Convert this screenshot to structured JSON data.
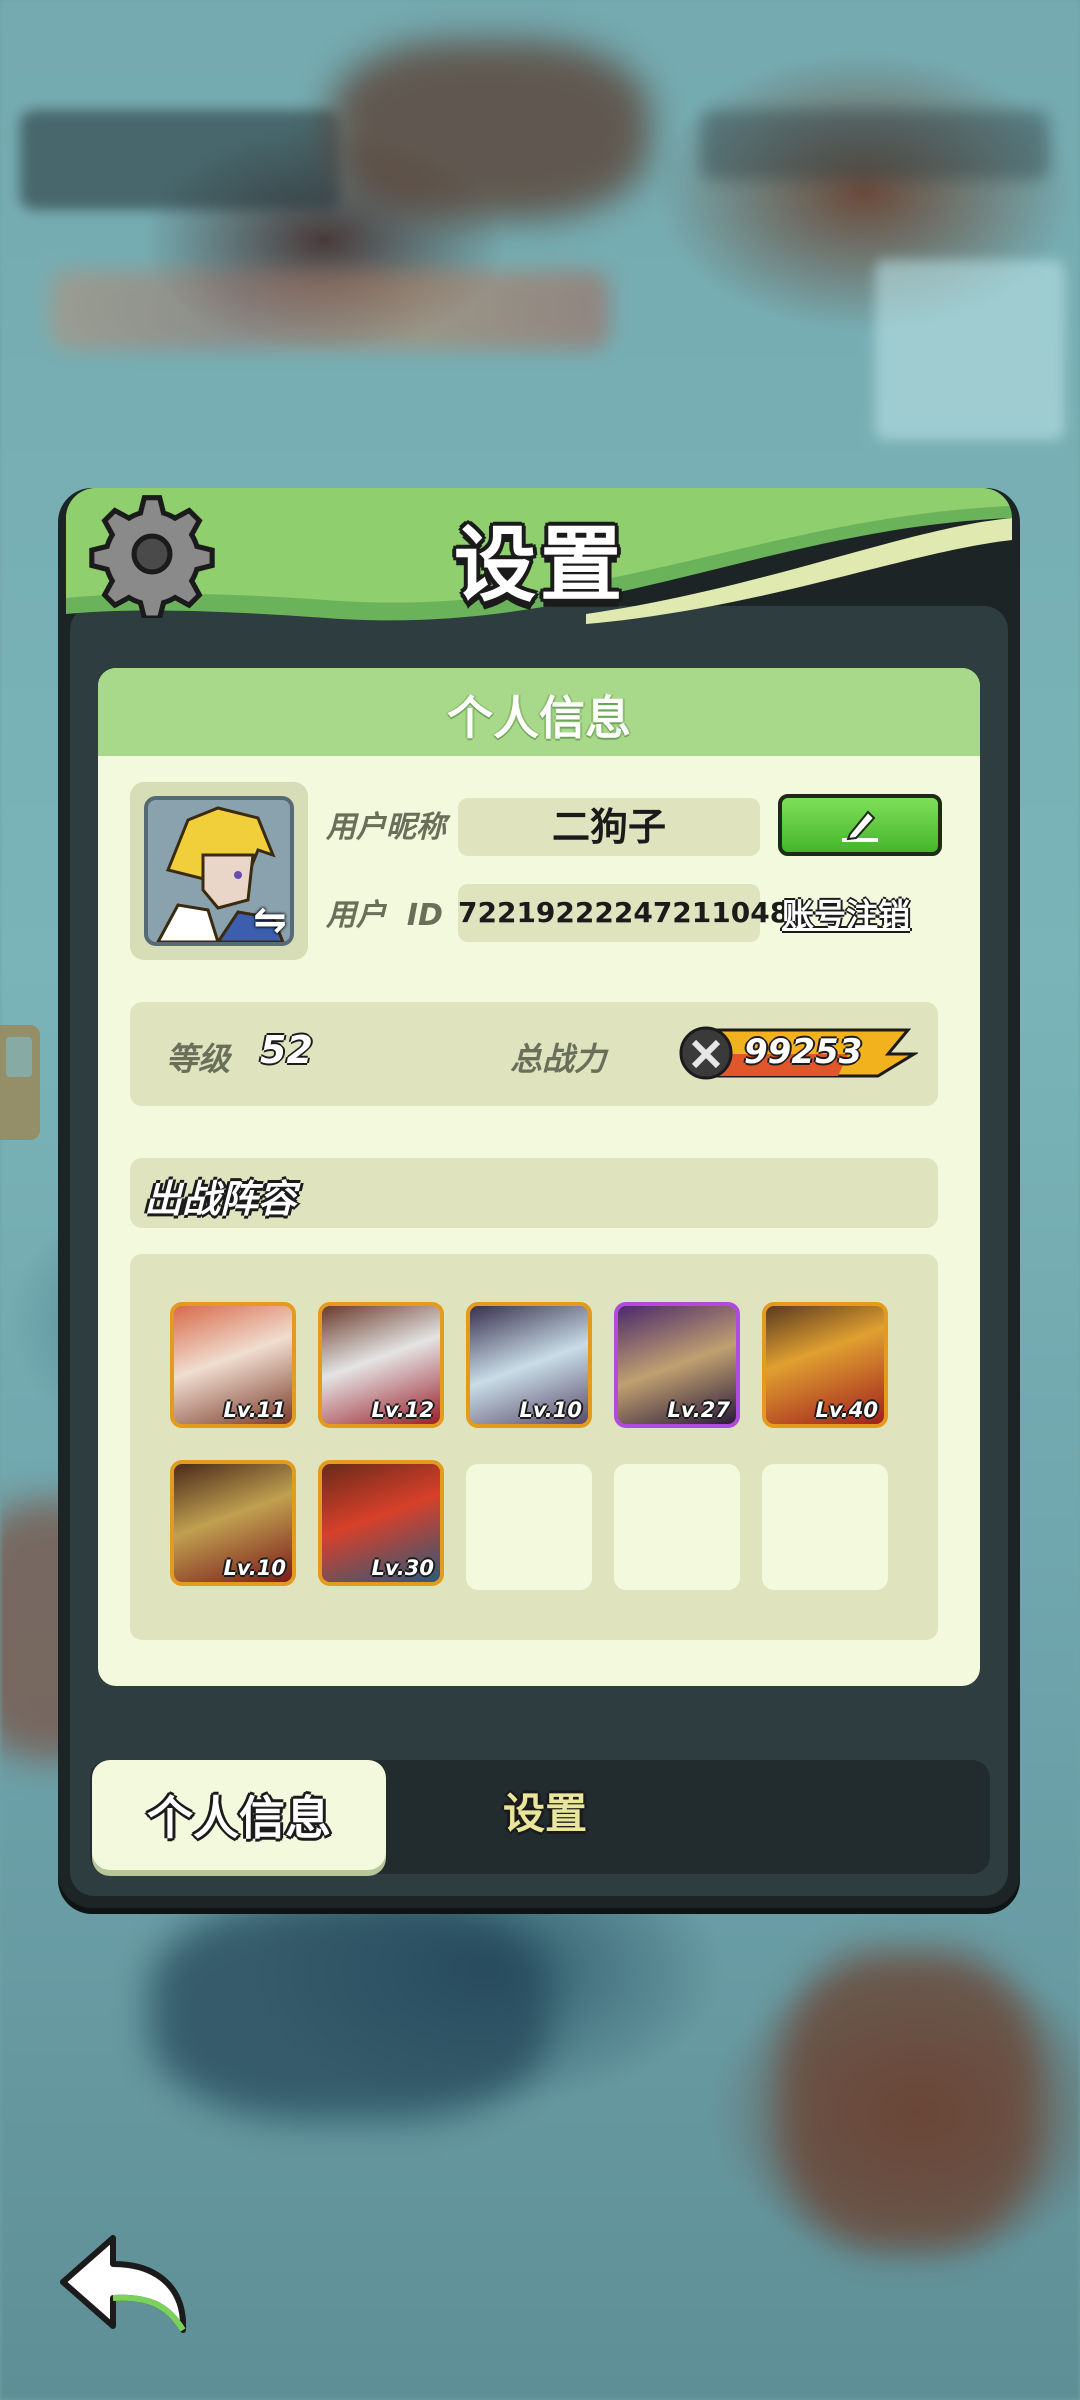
{
  "header": {
    "title": "设置"
  },
  "profile_section": {
    "title": "个人信息"
  },
  "profile": {
    "nickname_label": "用户昵称",
    "nickname_value": "二狗子",
    "id_label": "用户  ID",
    "id_value": "72219222247211048",
    "account_cancel_link": "账号注销"
  },
  "stats": {
    "level_label": "等级",
    "level_value": "52",
    "power_label": "总战力",
    "power_value": "99253"
  },
  "lineup": {
    "title": "出战阵容",
    "heroes": [
      {
        "level": "Lv.11",
        "frame": "orange"
      },
      {
        "level": "Lv.12",
        "frame": "orange"
      },
      {
        "level": "Lv.10",
        "frame": "orange"
      },
      {
        "level": "Lv.27",
        "frame": "purple"
      },
      {
        "level": "Lv.40",
        "frame": "orange"
      },
      {
        "level": "Lv.10",
        "frame": "orange"
      },
      {
        "level": "Lv.30",
        "frame": "orange"
      }
    ],
    "empty_slots": 3
  },
  "tabs": [
    {
      "label": "个人信息",
      "active": true
    },
    {
      "label": "设置",
      "active": false
    }
  ],
  "colors": {
    "header_green": "#a8d98a",
    "card_bg": "#f3f9dc",
    "edit_button": "#45b52c",
    "hero_frame_orange": "#e39a1d",
    "hero_frame_purple": "#b04be0"
  }
}
